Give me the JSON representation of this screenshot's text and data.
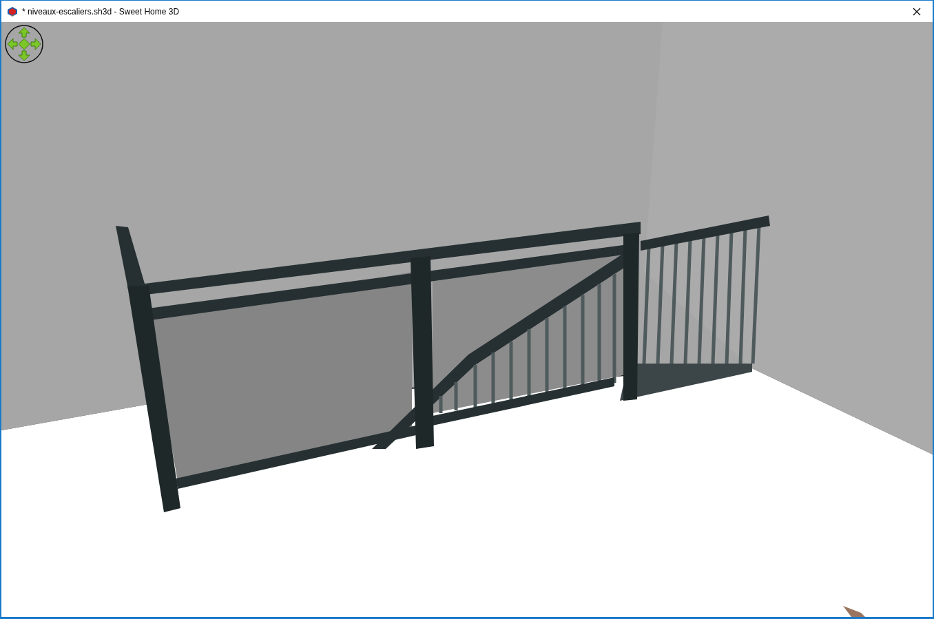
{
  "window": {
    "title": "* niveaux-escaliers.sh3d - Sweet Home 3D"
  }
}
